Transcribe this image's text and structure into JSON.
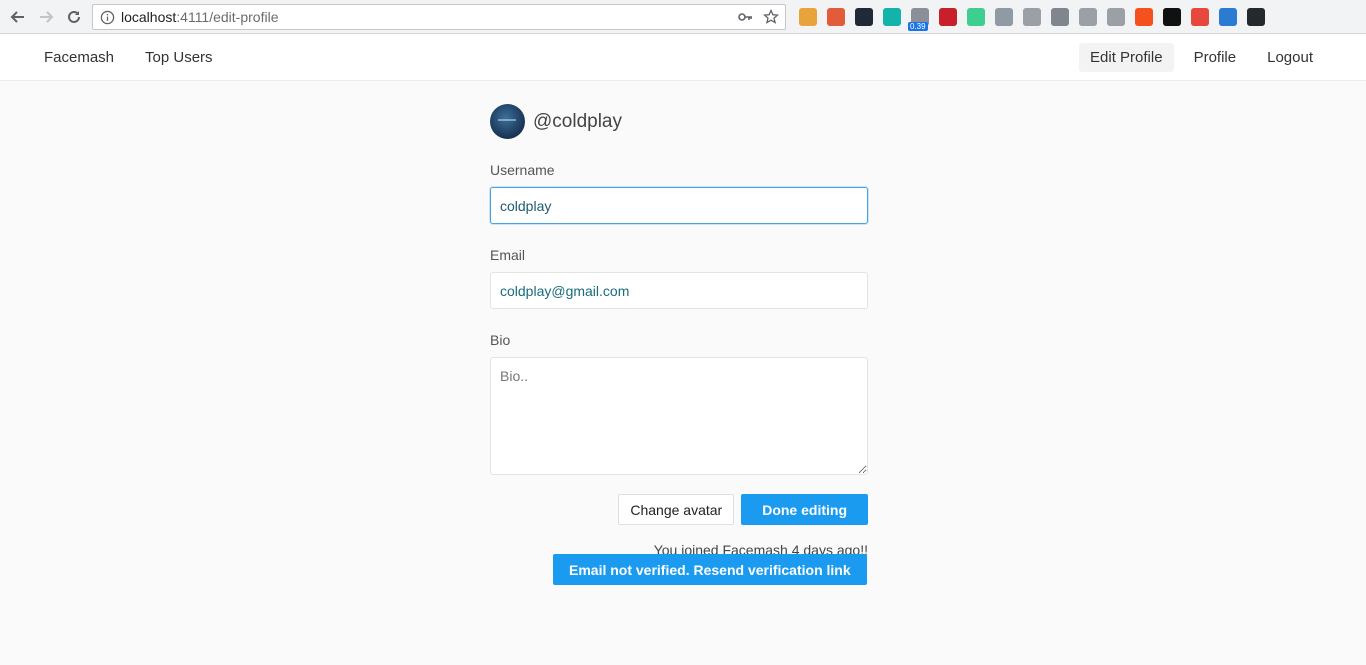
{
  "browser": {
    "url_host": "localhost",
    "url_rest": ":4111/edit-profile",
    "extensions": [
      {
        "name": "flag-ext-icon",
        "color": "#e8a33d"
      },
      {
        "name": "notes-ext-icon",
        "color": "#e25b3a"
      },
      {
        "name": "circle-ext-icon",
        "color": "#1f2937"
      },
      {
        "name": "m-ext-icon",
        "color": "#12b3a8"
      },
      {
        "name": "speed-ext-icon",
        "color": "#8a8f98",
        "badge": "0.39"
      },
      {
        "name": "red-ext-icon",
        "color": "#c7202a"
      },
      {
        "name": "target-ext-icon",
        "color": "#3ecf8e"
      },
      {
        "name": "vue-ext-icon",
        "color": "#8f9aa5"
      },
      {
        "name": "json-ext-icon",
        "color": "#9aa0a6"
      },
      {
        "name": "q-ext-icon",
        "color": "#7f868d"
      },
      {
        "name": "box-ext-icon",
        "color": "#9aa0a6"
      },
      {
        "name": "square-ext-icon",
        "color": "#9aa0a6"
      },
      {
        "name": "yc-ext-icon",
        "color": "#f4511e"
      },
      {
        "name": "github-ext-icon",
        "color": "#111111"
      },
      {
        "name": "asterisk-ext-icon",
        "color": "#e8473c"
      },
      {
        "name": "lambda-ext-icon",
        "color": "#2b7bd3"
      },
      {
        "name": "github2-ext-icon",
        "color": "#24292e"
      }
    ]
  },
  "navbar": {
    "left": [
      "Facemash",
      "Top Users"
    ],
    "right": [
      "Edit Profile",
      "Profile",
      "Logout"
    ]
  },
  "profile": {
    "handle": "@coldplay"
  },
  "form": {
    "username_label": "Username",
    "username_value": "coldplay",
    "email_label": "Email",
    "email_value": "coldplay@gmail.com",
    "bio_label": "Bio",
    "bio_placeholder": "Bio..",
    "change_avatar": "Change avatar",
    "done_editing": "Done editing",
    "joined_text": "You joined Facemash 4 days ago!!",
    "verify_text": "Email not verified. Resend verification link"
  },
  "colors": {
    "primary": "#1b9bef",
    "background": "#fafafa"
  }
}
